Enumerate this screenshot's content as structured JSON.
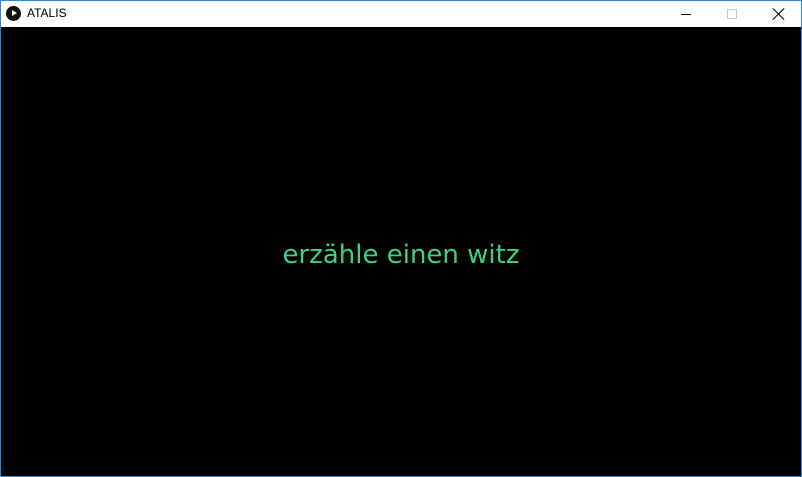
{
  "window": {
    "title": "ATALIS",
    "app_icon": "play-icon",
    "controls": {
      "minimize": "minimize-icon",
      "maximize": "maximize-icon",
      "close": "close-icon"
    }
  },
  "content": {
    "message": "erzähle einen witz",
    "message_color": "#3ed37a",
    "background_color": "#000000"
  }
}
